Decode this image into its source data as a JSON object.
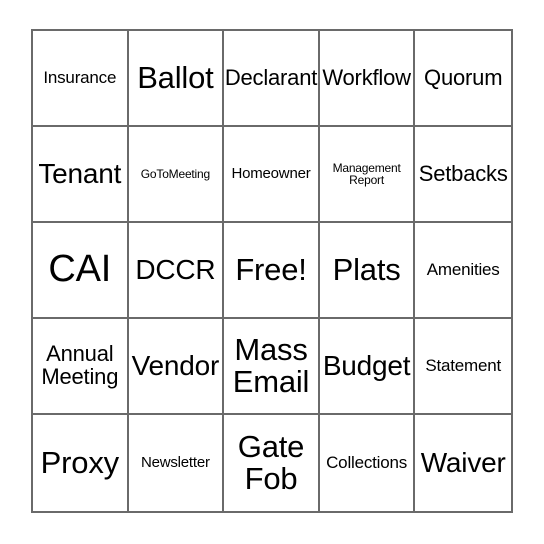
{
  "card": {
    "type": "bingo-card",
    "columns": 5,
    "rows": 5,
    "border_color": "#6a6a6a",
    "text_color": "#000000",
    "background_color": "#ffffff",
    "free_space": "Free!",
    "free_space_position": {
      "row": 3,
      "column": 3
    },
    "rows_data": [
      {
        "index": 1,
        "cells": [
          {
            "label": "Insurance",
            "size": "sm"
          },
          {
            "label": "Ballot",
            "size": "xl"
          },
          {
            "label": "Declarant",
            "size": "md"
          },
          {
            "label": "Workflow",
            "size": "md"
          },
          {
            "label": "Quorum",
            "size": "md"
          }
        ]
      },
      {
        "index": 2,
        "cells": [
          {
            "label": "Tenant",
            "size": "lg"
          },
          {
            "label": "GoToMeeting",
            "size": "xxs"
          },
          {
            "label": "Homeowner",
            "size": "xs"
          },
          {
            "label": "Management\nReport",
            "size": "xxs"
          },
          {
            "label": "Setbacks",
            "size": "md"
          }
        ]
      },
      {
        "index": 3,
        "cells": [
          {
            "label": "CAI",
            "size": "xxl"
          },
          {
            "label": "DCCR",
            "size": "lg"
          },
          {
            "label": "Free!",
            "size": "xl"
          },
          {
            "label": "Plats",
            "size": "xl"
          },
          {
            "label": "Amenities",
            "size": "sm"
          }
        ]
      },
      {
        "index": 4,
        "cells": [
          {
            "label": "Annual\nMeeting",
            "size": "md"
          },
          {
            "label": "Vendor",
            "size": "lg"
          },
          {
            "label": "Mass\nEmail",
            "size": "xl"
          },
          {
            "label": "Budget",
            "size": "lg"
          },
          {
            "label": "Statement",
            "size": "sm"
          }
        ]
      },
      {
        "index": 5,
        "cells": [
          {
            "label": "Proxy",
            "size": "xl"
          },
          {
            "label": "Newsletter",
            "size": "xs"
          },
          {
            "label": "Gate\nFob",
            "size": "xl"
          },
          {
            "label": "Collections",
            "size": "sm"
          },
          {
            "label": "Waiver",
            "size": "lg"
          }
        ]
      }
    ]
  }
}
